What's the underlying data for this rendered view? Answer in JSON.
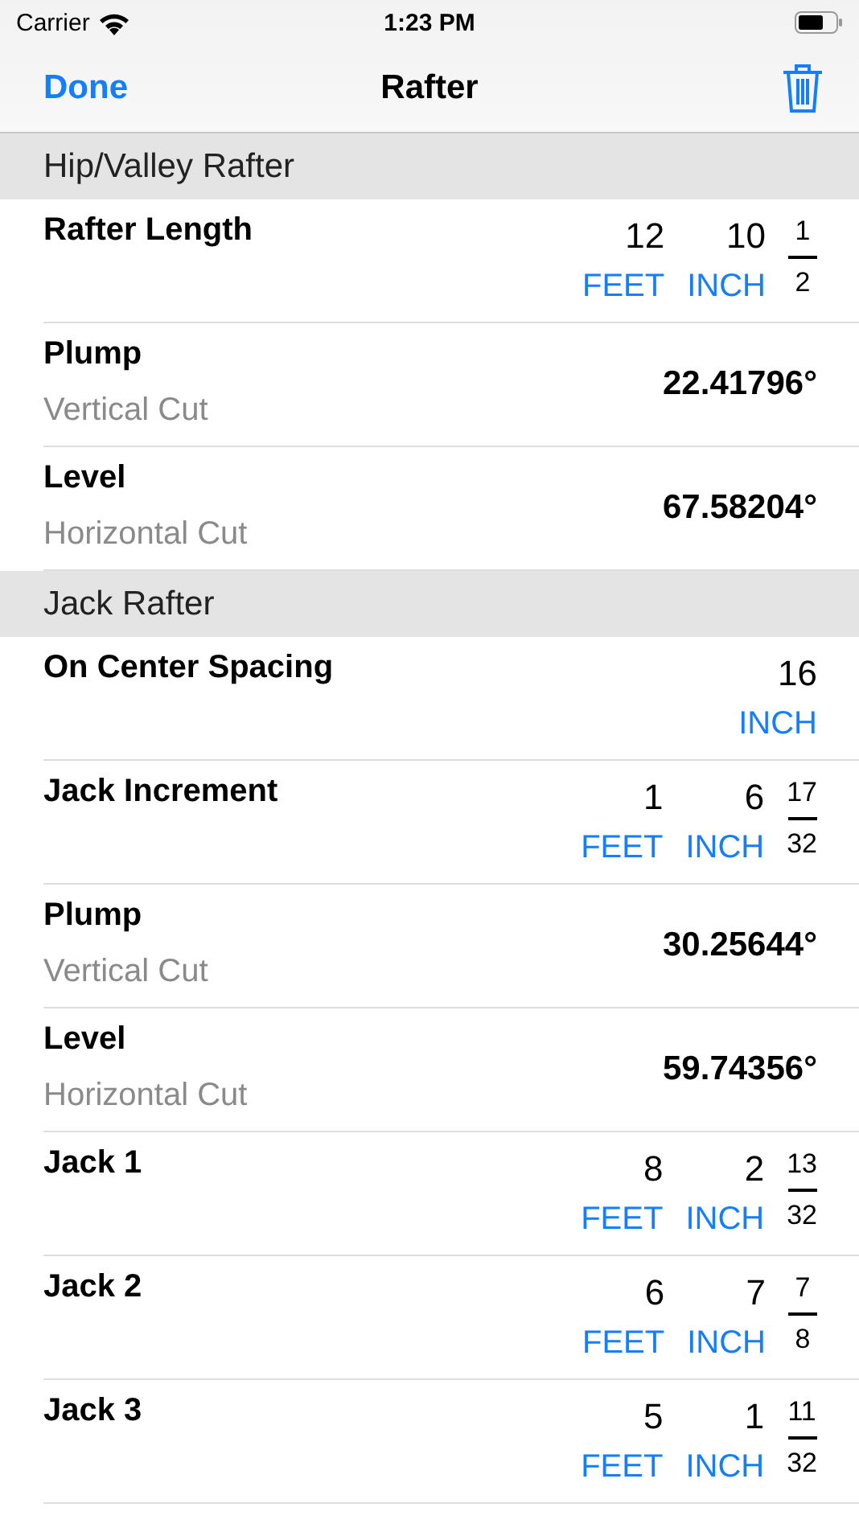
{
  "status_bar": {
    "carrier": "Carrier",
    "time": "1:23 PM"
  },
  "nav": {
    "left": "Done",
    "title": "Rafter"
  },
  "sections": [
    {
      "title": "Hip/Valley Rafter",
      "rows": [
        {
          "kind": "length",
          "label": "Rafter Length",
          "feet": "12",
          "feet_unit": "FEET",
          "inch": "10",
          "inch_unit": "INCH",
          "numerator": "1",
          "denominator": "2"
        },
        {
          "kind": "angle",
          "label": "Plump",
          "sublabel": "Vertical Cut",
          "value": "22.41796°"
        },
        {
          "kind": "angle",
          "label": "Level",
          "sublabel": "Horizontal Cut",
          "value": "67.58204°"
        }
      ]
    },
    {
      "title": "Jack Rafter",
      "rows": [
        {
          "kind": "inch",
          "label": "On Center Spacing",
          "inch": "16",
          "inch_unit": "INCH"
        },
        {
          "kind": "length",
          "label": "Jack Increment",
          "feet": "1",
          "feet_unit": "FEET",
          "inch": "6",
          "inch_unit": "INCH",
          "numerator": "17",
          "denominator": "32"
        },
        {
          "kind": "angle",
          "label": "Plump",
          "sublabel": "Vertical Cut",
          "value": "30.25644°"
        },
        {
          "kind": "angle",
          "label": "Level",
          "sublabel": "Horizontal Cut",
          "value": "59.74356°"
        },
        {
          "kind": "length",
          "label": "Jack 1",
          "feet": "8",
          "feet_unit": "FEET",
          "inch": "2",
          "inch_unit": "INCH",
          "numerator": "13",
          "denominator": "32"
        },
        {
          "kind": "length",
          "label": "Jack 2",
          "feet": "6",
          "feet_unit": "FEET",
          "inch": "7",
          "inch_unit": "INCH",
          "numerator": "7",
          "denominator": "8"
        },
        {
          "kind": "length",
          "label": "Jack 3",
          "feet": "5",
          "feet_unit": "FEET",
          "inch": "1",
          "inch_unit": "INCH",
          "numerator": "11",
          "denominator": "32"
        }
      ]
    }
  ]
}
